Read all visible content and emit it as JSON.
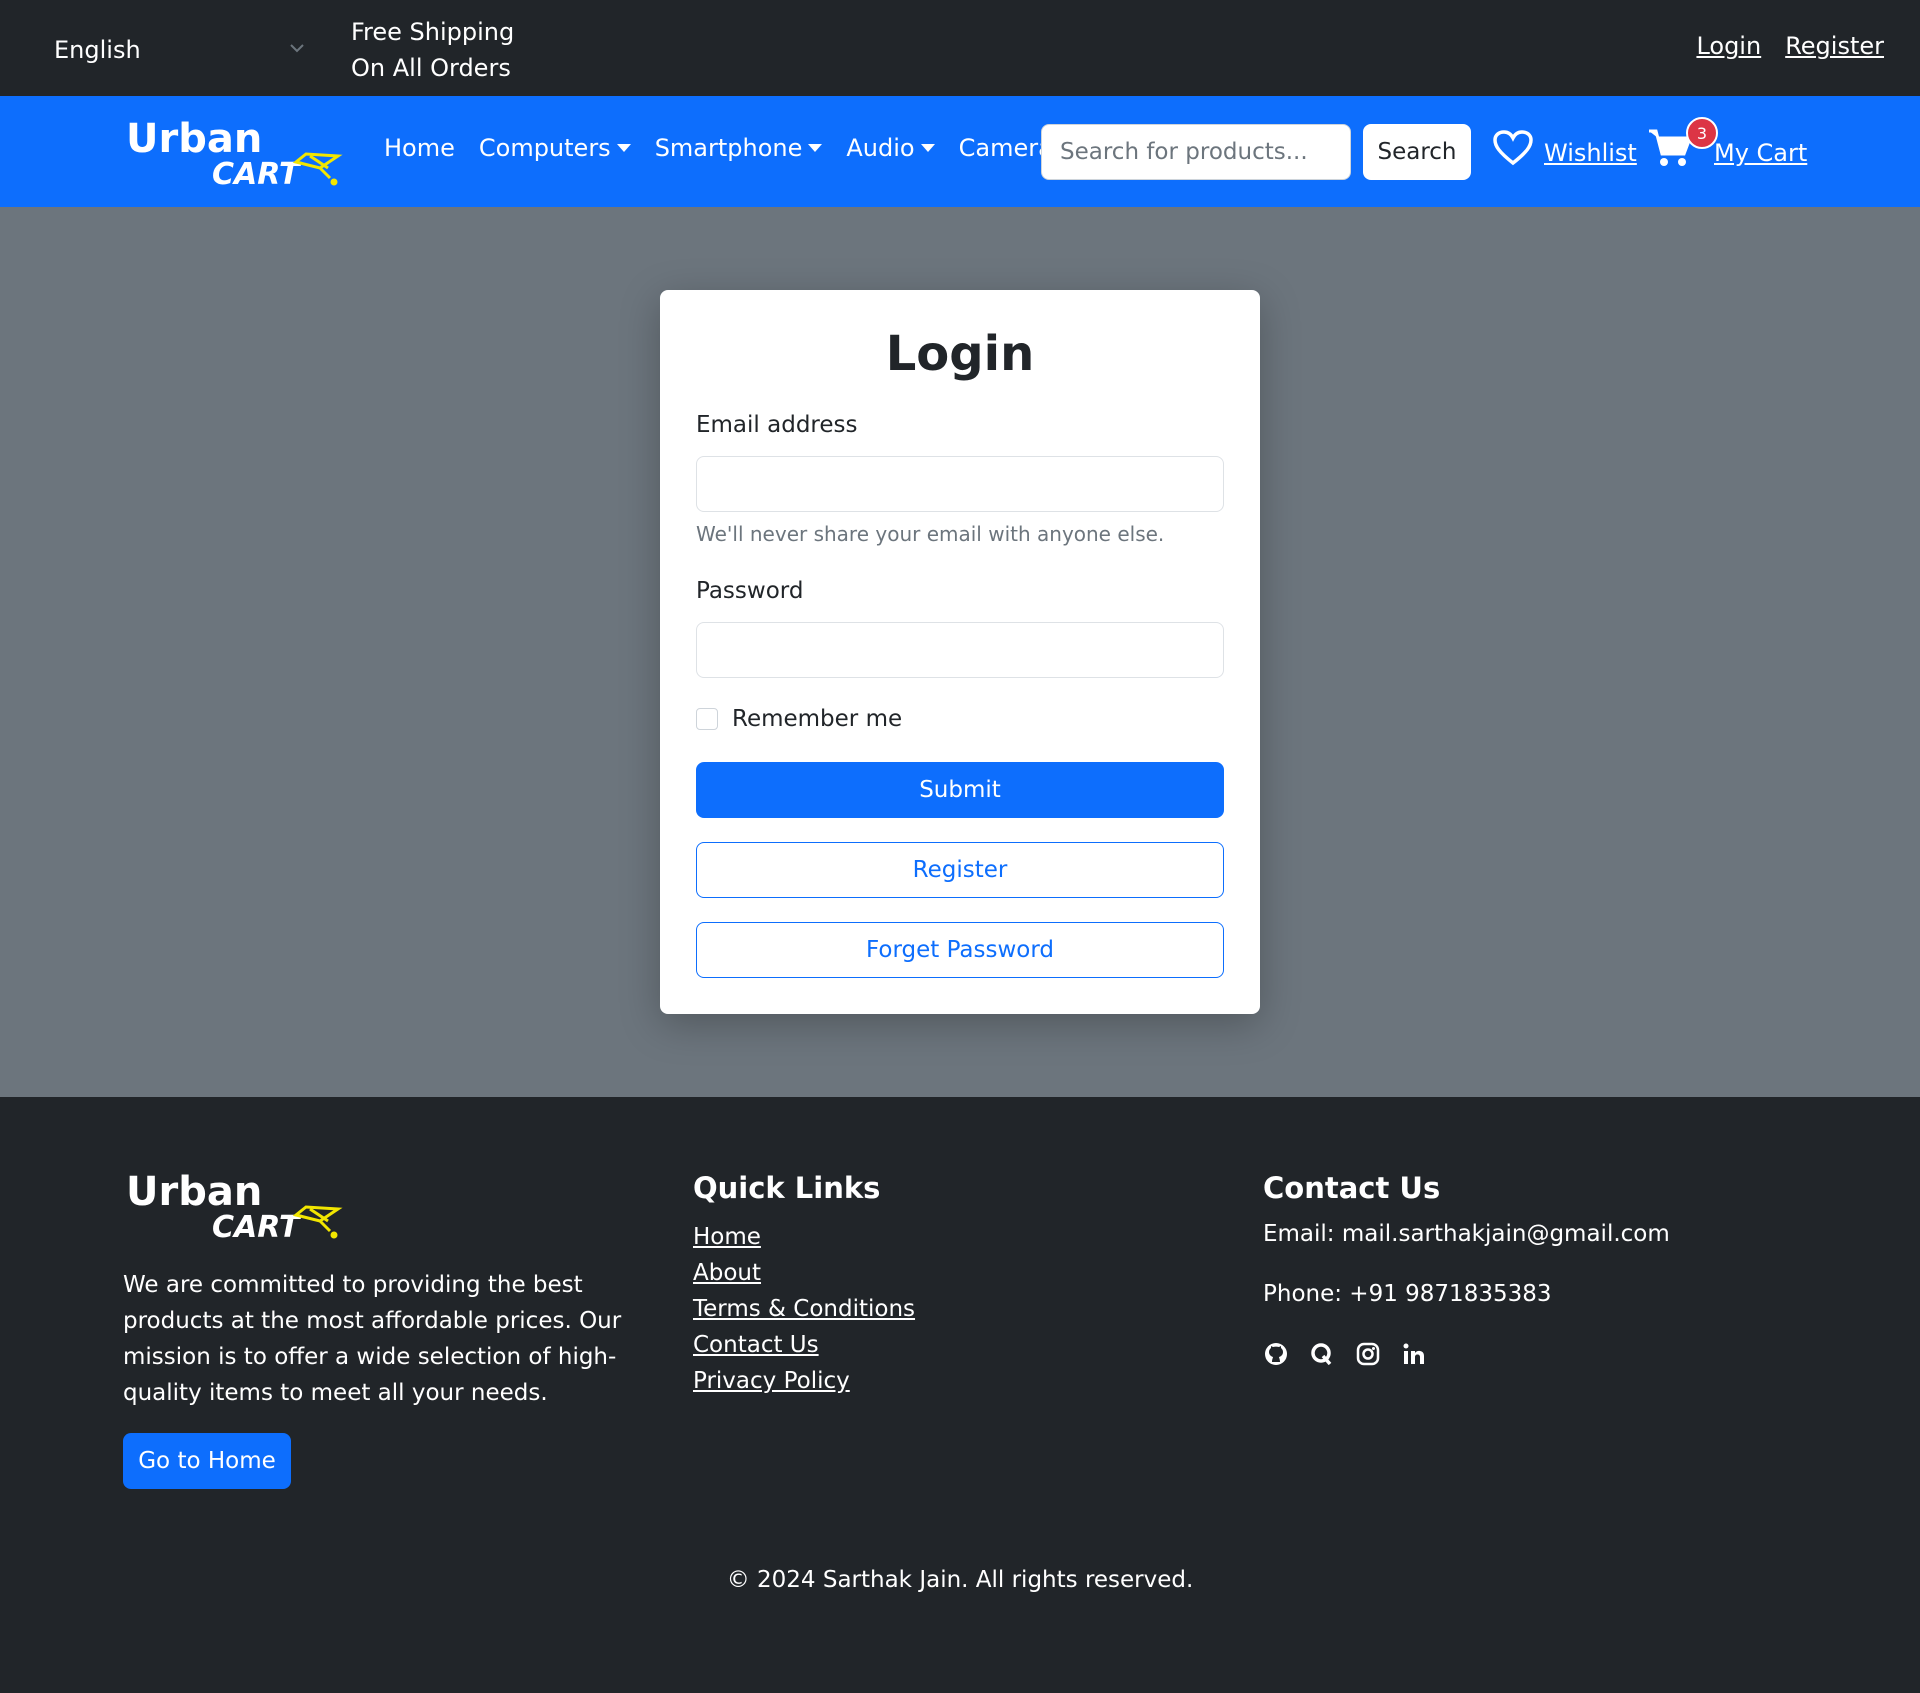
{
  "topbar": {
    "language": "English",
    "shipping_line1": "Free Shipping",
    "shipping_line2": "On All Orders",
    "login": "Login",
    "register": "Register"
  },
  "navbar": {
    "logo_word1": "Urban",
    "logo_word2": "CART",
    "items": [
      {
        "label": "Home"
      },
      {
        "label": "Computers"
      },
      {
        "label": "Smartphone"
      },
      {
        "label": "Audio"
      },
      {
        "label": "Camera"
      }
    ],
    "search_placeholder": "Search for products...",
    "search_button": "Search",
    "wishlist": "Wishlist",
    "cart_count": "3",
    "cart": "My Cart"
  },
  "login": {
    "title": "Login",
    "email_label": "Email address",
    "email_value": "",
    "email_help": "We'll never share your email with anyone else.",
    "password_label": "Password",
    "password_value": "",
    "remember_label": "Remember me",
    "submit": "Submit",
    "register": "Register",
    "forget": "Forget Password"
  },
  "footer": {
    "about": "We are committed to providing the best products at the most affordable prices. Our mission is to offer a wide selection of high-quality items to meet all your needs.",
    "home_button": "Go to Home",
    "quick_links_title": "Quick Links",
    "quick_links": [
      {
        "label": "Home"
      },
      {
        "label": "About"
      },
      {
        "label": "Terms & Conditions"
      },
      {
        "label": "Contact Us"
      },
      {
        "label": "Privacy Policy"
      }
    ],
    "contact_title": "Contact Us",
    "email": "Email: mail.sarthakjain@gmail.com",
    "phone": "Phone: +91 9871835383",
    "copyright": "© 2024 Sarthak Jain. All rights reserved."
  },
  "colors": {
    "primary": "#0d6efd",
    "dark": "#212529",
    "page_bg": "#6c757d",
    "logo_accent": "#f2e600"
  },
  "icons": [
    "chevron-down-icon",
    "heart-icon",
    "cart-icon",
    "github-icon",
    "quora-icon",
    "instagram-icon",
    "linkedin-icon"
  ]
}
